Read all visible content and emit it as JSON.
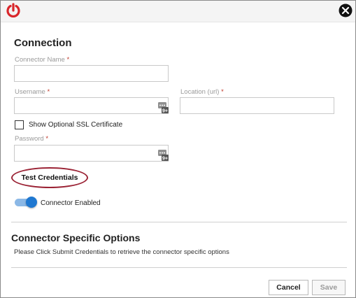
{
  "header": {
    "logo_icon": "power-icon",
    "close_icon": "close-icon"
  },
  "connection": {
    "title": "Connection",
    "connector_name_label": "Connector Name",
    "username_label": "Username",
    "location_label": "Location (url)",
    "ssl_label": "Show Optional SSL Certificate",
    "password_label": "Password",
    "required_mark": "*",
    "keypass_badge": "9+",
    "test_button": "Test Credentials",
    "connector_enabled_label": "Connector Enabled",
    "connector_enabled": true,
    "show_ssl_checked": false
  },
  "options": {
    "title": "Connector Specific Options",
    "hint": "Please Click Submit Credentials to retrieve the connector specific options"
  },
  "footer": {
    "cancel": "Cancel",
    "save": "Save"
  },
  "colors": {
    "accent": "#1f78d1",
    "highlight_ring": "#9b2335",
    "logo_red": "#d9262b",
    "required": "#c0392b"
  }
}
